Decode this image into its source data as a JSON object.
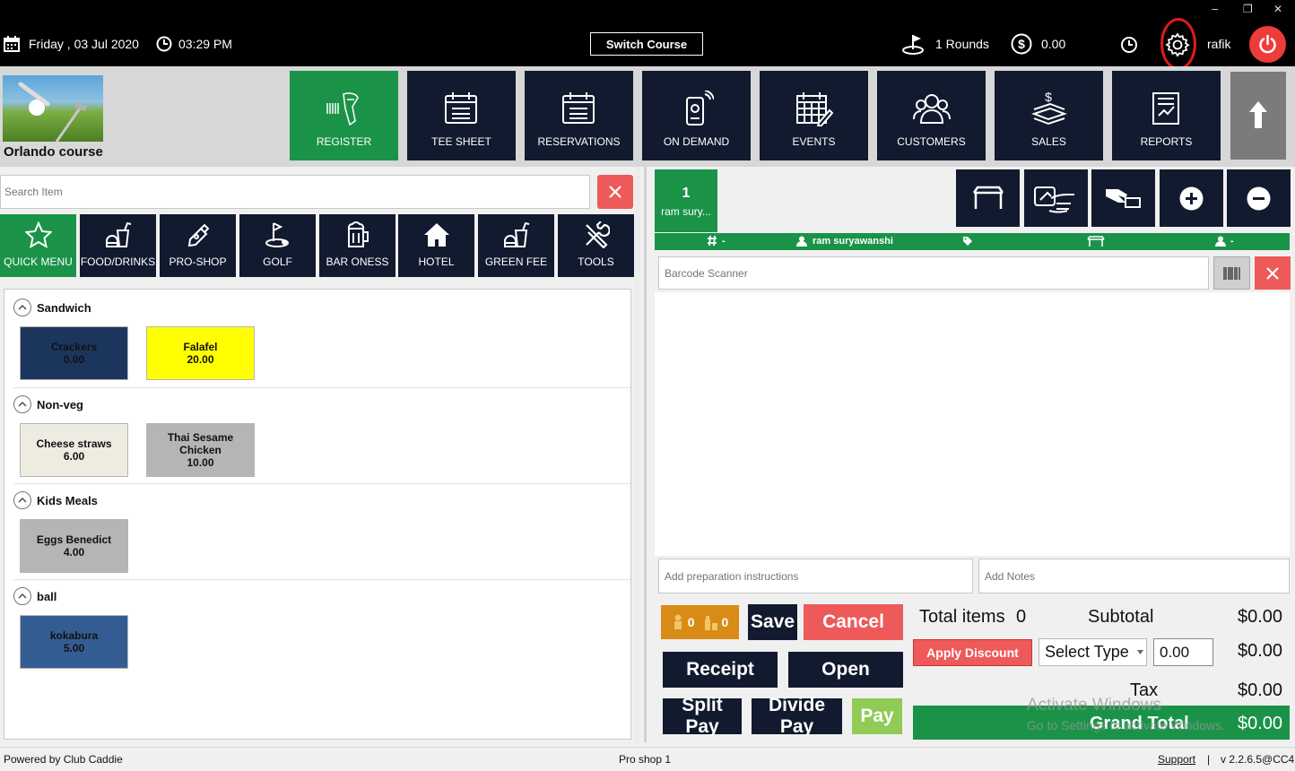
{
  "window": {
    "minimize": "–",
    "restore": "❐",
    "close": "✕"
  },
  "topbar": {
    "date": "Friday ,  03 Jul 2020",
    "time": "03:29 PM",
    "switch_course": "Switch Course",
    "rounds": "1 Rounds",
    "balance": "0.00",
    "user": "rafik"
  },
  "course": {
    "name": "Orlando course"
  },
  "nav": {
    "register": "REGISTER",
    "tee_sheet": "TEE SHEET",
    "reservations": "RESERVATIONS",
    "on_demand": "ON DEMAND",
    "events": "EVENTS",
    "customers": "CUSTOMERS",
    "sales": "SALES",
    "reports": "REPORTS"
  },
  "search": {
    "placeholder": "Search Item"
  },
  "categories": {
    "quick_menu": "QUICK MENU",
    "food_drinks": "FOOD/DRINKS",
    "pro_shop": "PRO-SHOP",
    "golf": "GOLF",
    "bar_oness": "BAR ONESS",
    "hotel": "HOTEL",
    "green_fee": "GREEN FEE",
    "tools": "TOOLS"
  },
  "sections": [
    {
      "title": "Sandwich",
      "items": [
        {
          "name": "Crackers",
          "price": "0.00",
          "bg": "#1b355c"
        },
        {
          "name": "Falafel",
          "price": "20.00",
          "bg": "#ffff00"
        }
      ]
    },
    {
      "title": "Non-veg",
      "items": [
        {
          "name": "Cheese straws",
          "price": "6.00",
          "bg": "#eeece1"
        },
        {
          "name": "Thai Sesame Chicken",
          "price": "10.00",
          "bg": "#b5b5b5"
        }
      ]
    },
    {
      "title": "Kids Meals",
      "items": [
        {
          "name": "Eggs Benedict",
          "price": "4.00",
          "bg": "#b5b5b5"
        }
      ]
    },
    {
      "title": "ball",
      "items": [
        {
          "name": "kokabura",
          "price": "5.00",
          "bg": "#335d92"
        }
      ]
    }
  ],
  "order": {
    "tab_number": "1",
    "tab_name": "ram sury...",
    "strip": {
      "number": "-",
      "customer": "ram suryawanshi",
      "player": "-"
    },
    "barcode_placeholder": "Barcode Scanner",
    "prep_placeholder": "Add preparation instructions",
    "notes_placeholder": "Add Notes"
  },
  "actions": {
    "count_a": "0",
    "count_b": "0",
    "save": "Save",
    "cancel": "Cancel",
    "receipt": "Receipt",
    "open": "Open",
    "split_pay": "Split Pay",
    "divide_pay": "Divide Pay",
    "pay": "Pay"
  },
  "totals": {
    "total_items_label": "Total items",
    "total_items": "0",
    "subtotal_label": "Subtotal",
    "subtotal": "$0.00",
    "apply_discount": "Apply Discount",
    "select_type": "Select Type",
    "discount_value": "0.00",
    "discount_amount": "$0.00",
    "tax_label": "Tax",
    "tax": "$0.00",
    "grand_total_label": "Grand Total",
    "grand_total": "$0.00"
  },
  "watermark": {
    "line1": "Activate Windows",
    "line2": "Go to Settings to activate Windows."
  },
  "footer": {
    "powered_by": "Powered by Club Caddie",
    "station": "Pro shop 1",
    "support": "Support",
    "separator": "|",
    "version": "v 2.2.6.5@CC4"
  },
  "colors": {
    "green": "#1a9349",
    "navy": "#111a2e",
    "red": "#ee5a5a",
    "orange": "#d88b16",
    "lime": "#8fcb55"
  }
}
